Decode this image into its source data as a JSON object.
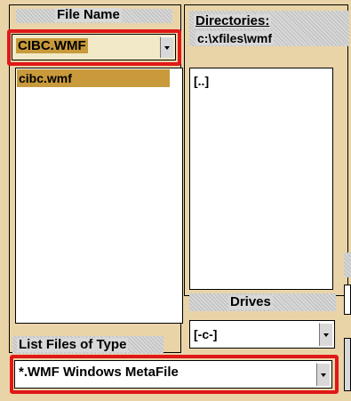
{
  "file_name": {
    "header": "File Name",
    "value": "CIBC.WMF",
    "list": [
      "cibc.wmf"
    ]
  },
  "directories": {
    "header": "Directories:",
    "path": "c:\\xfiles\\wmf",
    "list": [
      "[..]"
    ]
  },
  "drives": {
    "header": "Drives",
    "value": "[-c-]"
  },
  "file_type": {
    "header": "List Files of Type",
    "value": "*.WMF Windows MetaFile"
  },
  "colors": {
    "dialog_bg": "#e9d4a8",
    "highlight_red": "#e01818",
    "selection_gold": "#c89a3c"
  }
}
